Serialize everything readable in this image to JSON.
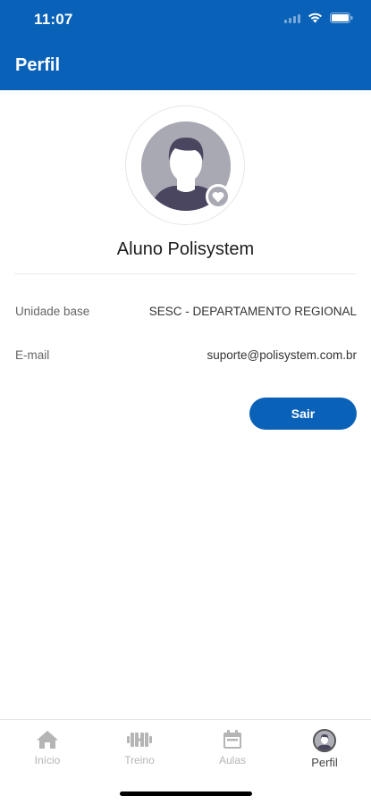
{
  "status_bar": {
    "time": "11:07"
  },
  "app_bar": {
    "title": "Perfil"
  },
  "profile": {
    "name": "Aluno Polisystem",
    "fields": [
      {
        "label": "Unidade base",
        "value": "SESC - DEPARTAMENTO REGIONAL"
      },
      {
        "label": "E-mail",
        "value": "suporte@polisystem.com.br"
      }
    ],
    "logout_label": "Sair"
  },
  "tab_bar": {
    "tabs": [
      {
        "label": "Início",
        "icon": "home-icon",
        "active": false
      },
      {
        "label": "Treino",
        "icon": "dumbbell-icon",
        "active": false
      },
      {
        "label": "Aulas",
        "icon": "calendar-icon",
        "active": false
      },
      {
        "label": "Perfil",
        "icon": "profile-avatar-icon",
        "active": true
      }
    ]
  },
  "colors": {
    "primary": "#0a62b8",
    "avatar_bg": "#a9a9b3",
    "inactive_tab": "#b5b5b5"
  }
}
